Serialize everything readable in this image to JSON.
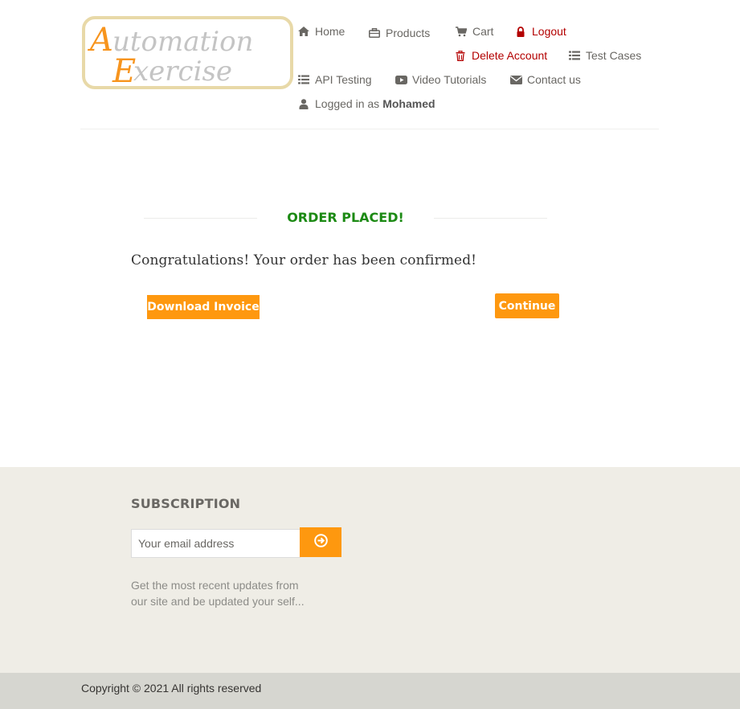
{
  "brand": {
    "logo_line1": "Automation",
    "logo_line2": "Exercise",
    "logo_accent_color": "#f7941d",
    "logo_text_color": "#c4c4c4",
    "logo_border_color": "#e8d9a8"
  },
  "nav": {
    "home": {
      "label": "Home",
      "icon": "home-icon"
    },
    "products": {
      "label": "Products",
      "icon": "briefcase-icon"
    },
    "cart": {
      "label": "Cart",
      "icon": "cart-icon"
    },
    "logout": {
      "label": "Logout",
      "icon": "lock-icon"
    },
    "delete_account": {
      "label": "Delete Account",
      "icon": "trash-icon"
    },
    "test_cases": {
      "label": "Test Cases",
      "icon": "list-icon"
    },
    "api_testing": {
      "label": "API Testing",
      "icon": "list-icon"
    },
    "video_tutorials": {
      "label": "Video Tutorials",
      "icon": "youtube-play-icon"
    },
    "contact_us": {
      "label": "Contact us",
      "icon": "envelope-icon"
    },
    "logged_in_prefix": "Logged in as",
    "logged_in_user": "Mohamed"
  },
  "order": {
    "title": "ORDER PLACED!",
    "message": "Congratulations! Your order has been confirmed!",
    "download_label": "Download Invoice",
    "continue_label": "Continue"
  },
  "subscription": {
    "title": "SUBSCRIPTION",
    "email_placeholder": "Your email address",
    "description": "Get the most recent updates from our site and be updated your self..."
  },
  "footer": {
    "copyright": "Copyright © 2021 All rights reserved"
  },
  "colors": {
    "accent": "#fe980f",
    "success": "#1c8a14",
    "danger": "#b30000",
    "footer_bg": "#efede6",
    "footer_bottom_bg": "#d6d6d0"
  }
}
